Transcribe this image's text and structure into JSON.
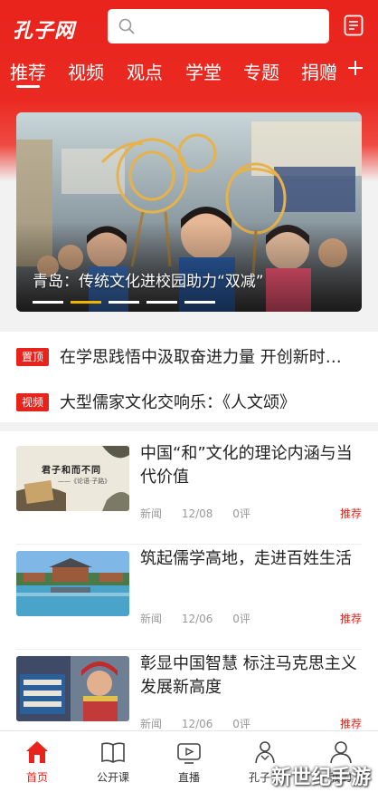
{
  "brand": {
    "logo_text": "孔子网",
    "accent": "#e8231c"
  },
  "search": {
    "placeholder": ""
  },
  "icons": {
    "search": "search-icon",
    "message": "message-icon",
    "more": "plus-icon"
  },
  "tabs": [
    "推荐",
    "视频",
    "观点",
    "学堂",
    "专题",
    "捐赠"
  ],
  "active_tab": "推荐",
  "banner": {
    "caption": "青岛：传统文化进校园助力“双减”",
    "slide_count": 5,
    "active_slide": 2
  },
  "headlines": [
    {
      "badge": "置顶",
      "text": "在学思践悟中汲取奋进力量 开创新时…"
    },
    {
      "badge": "视频",
      "text": "大型儒家文化交响乐：《人文颂》"
    }
  ],
  "articles": [
    {
      "title": "中国“和”文化的理论内涵与当代价值",
      "category": "新闻",
      "date": "12/08",
      "comments": "0评",
      "tag": "推荐",
      "thumb_text": "君子和而不同",
      "thumb_sub": "——《论语·子路》"
    },
    {
      "title": "筑起儒学高地，走进百姓生活",
      "category": "新闻",
      "date": "12/06",
      "comments": "0评",
      "tag": "推荐"
    },
    {
      "title": "彰显中国智慧 标注马克思主义发展新高度",
      "category": "新闻",
      "date": "12/06",
      "comments": "0评",
      "tag": "推荐"
    }
  ],
  "tabbar": [
    {
      "label": "首页",
      "icon": "home-icon",
      "active": true
    },
    {
      "label": "公开课",
      "icon": "book-icon",
      "active": false
    },
    {
      "label": "直播",
      "icon": "tv-icon",
      "active": false
    },
    {
      "label": "孔子号",
      "icon": "confucius-icon",
      "active": false
    },
    {
      "label": "我的",
      "icon": "user-icon",
      "active": false
    }
  ],
  "watermark": "新世纪手游"
}
